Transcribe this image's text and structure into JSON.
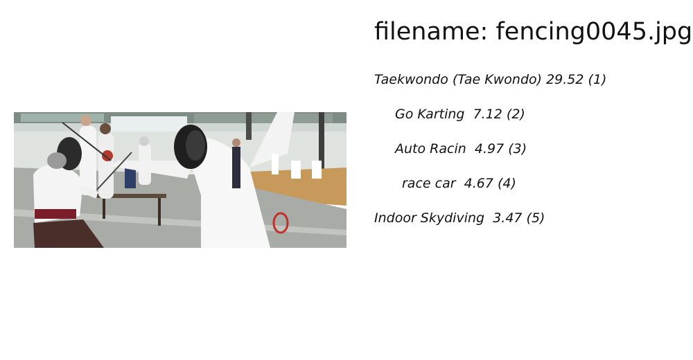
{
  "image": {
    "alt": "fencing",
    "icon": "photo"
  },
  "filename_prefix": "filename: ",
  "filename": "fencing0045.jpg",
  "predictions": [
    {
      "label": "Taekwondo (Tae Kwondo)",
      "score": "29.52",
      "rank": "(1)"
    },
    {
      "label": "Go Karting",
      "score": "7.12",
      "rank": "(2)"
    },
    {
      "label": "Auto Racin",
      "score": "4.97",
      "rank": "(3)"
    },
    {
      "label": "race car",
      "score": "4.67",
      "rank": "(4)"
    },
    {
      "label": "Indoor Skydiving",
      "score": "3.47",
      "rank": "(5)"
    }
  ]
}
